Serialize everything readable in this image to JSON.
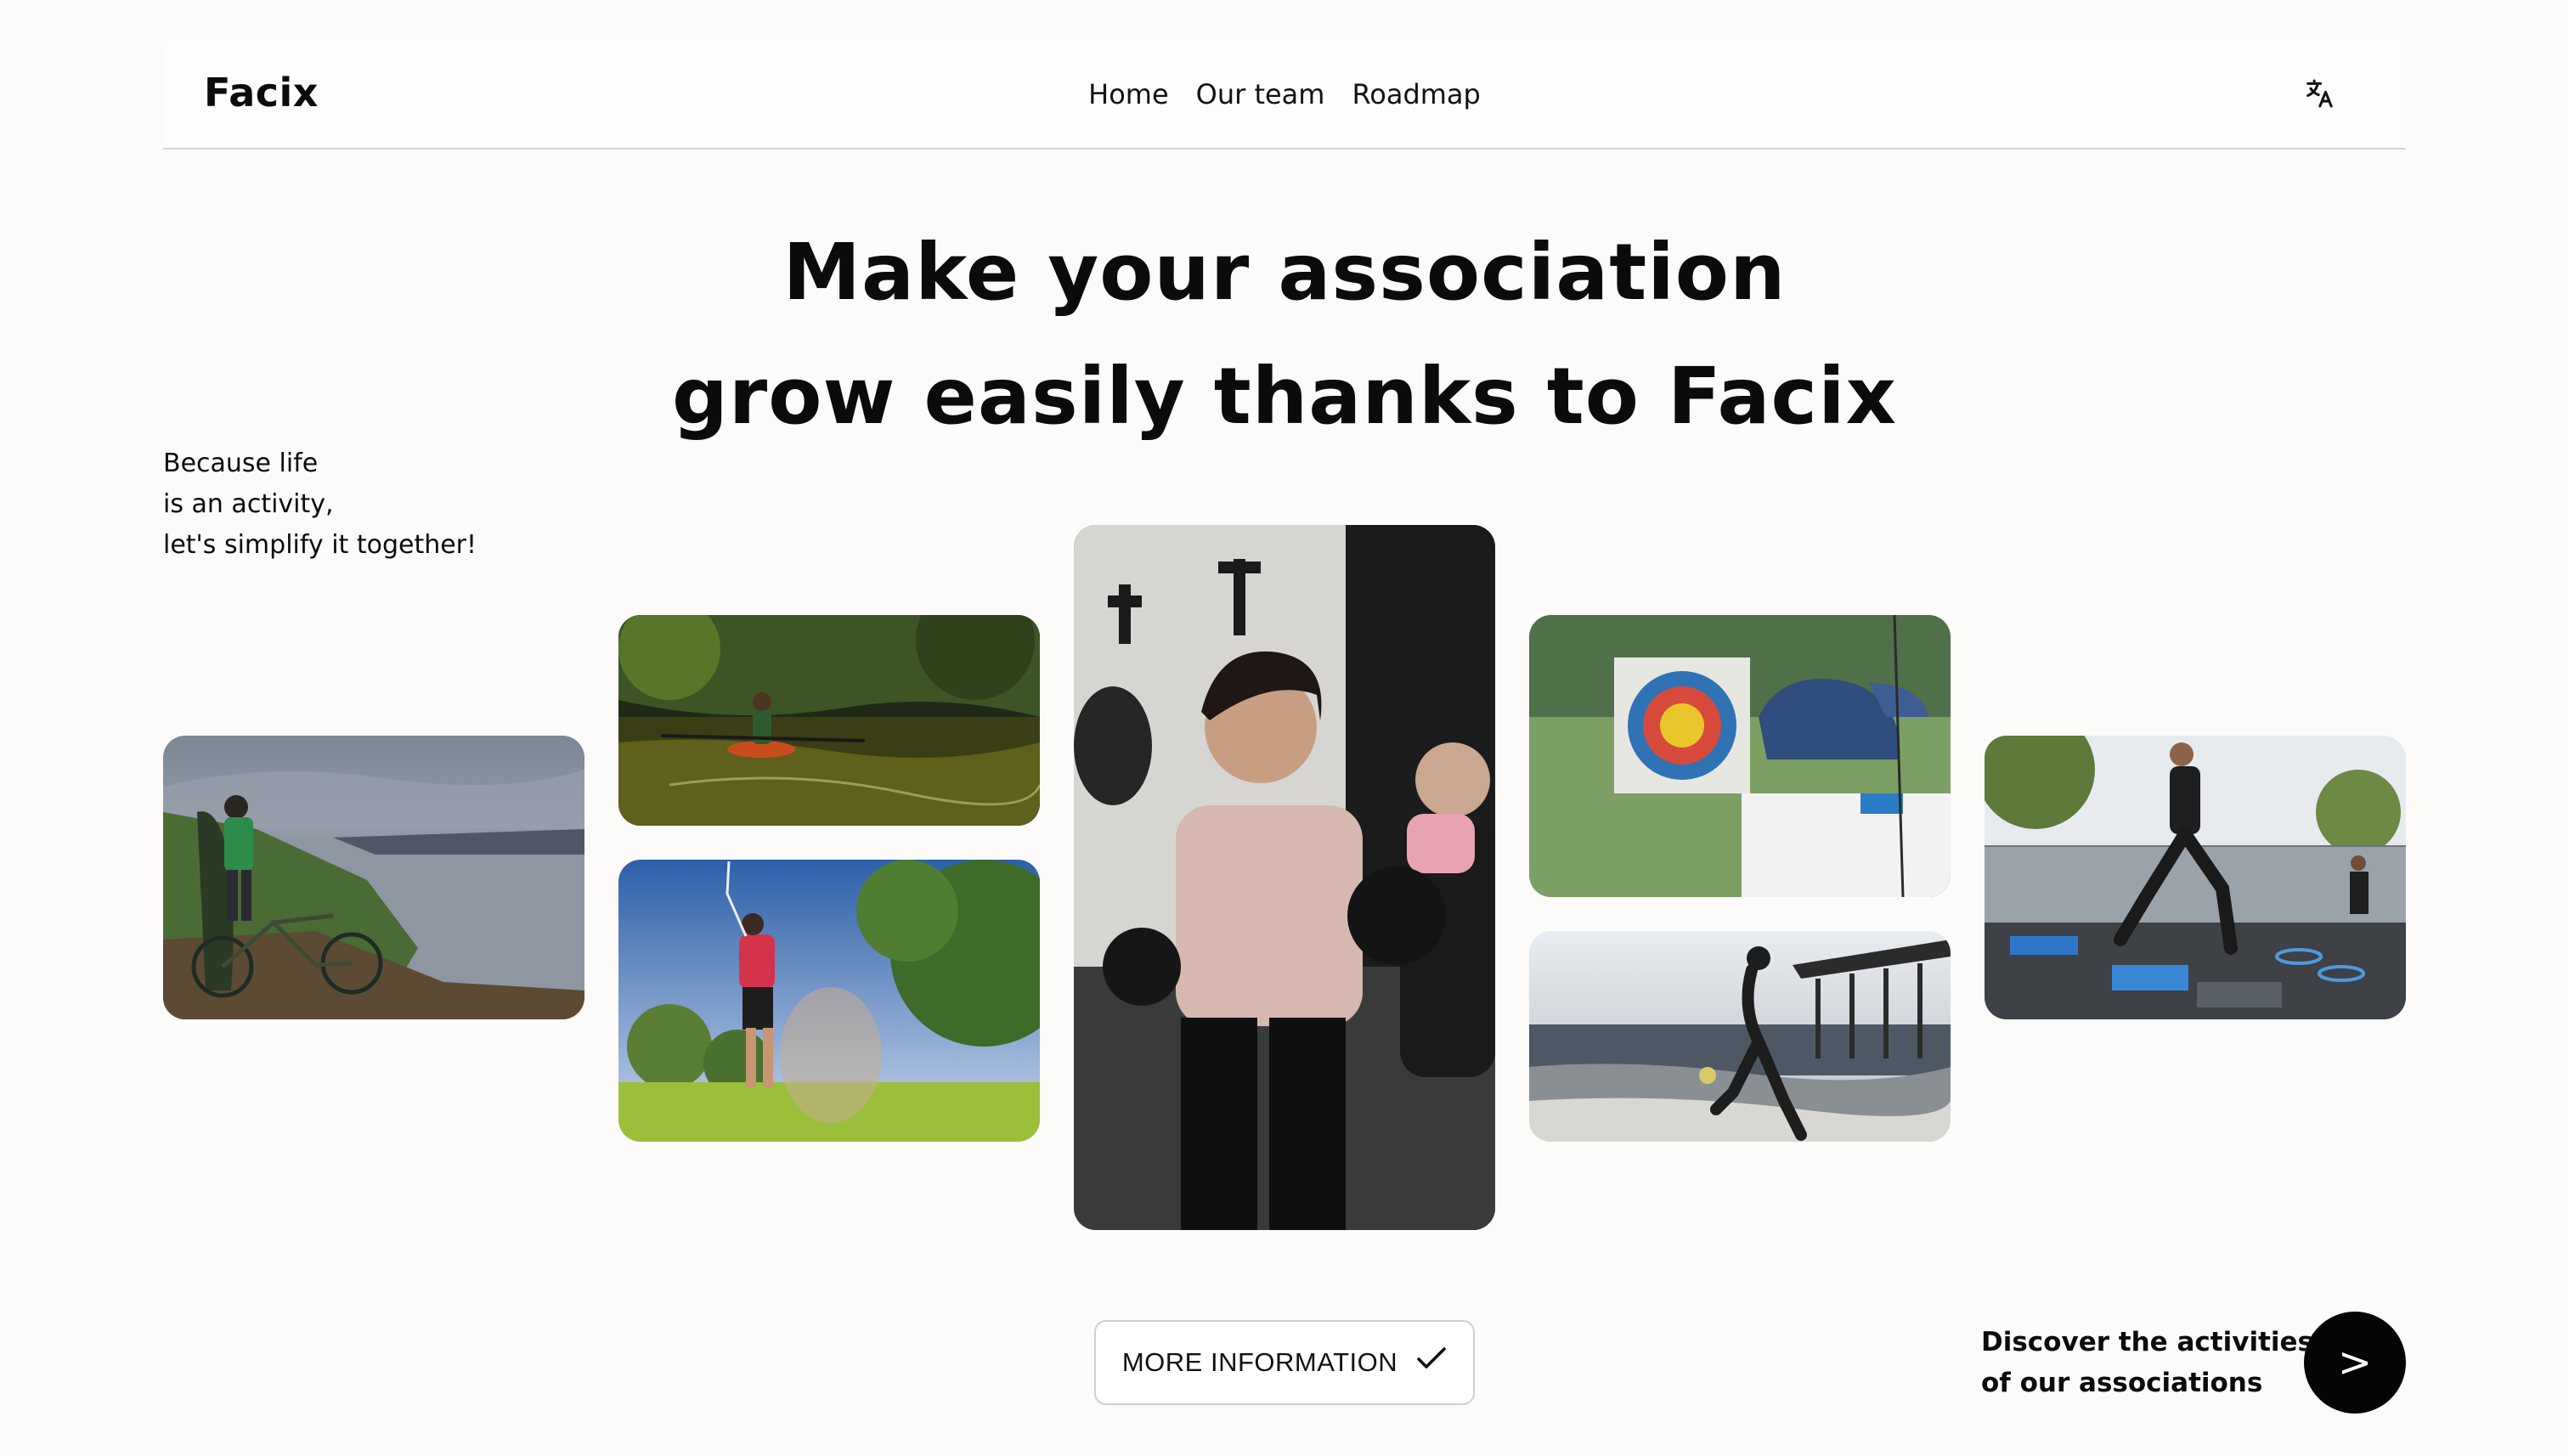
{
  "header": {
    "logo": "Facix",
    "nav": [
      "Home",
      "Our team",
      "Roadmap"
    ],
    "language_icon": "translate-icon"
  },
  "hero": {
    "title_line1": "Make your association",
    "title_line2": "grow easily thanks to Facix",
    "tagline": [
      "Because life",
      "is an activity,",
      "let's simplify it together!"
    ]
  },
  "photos": [
    "cyclist-on-cliff-photo",
    "kayaker-on-river-photo",
    "golfer-swing-photo",
    "boxing-women-photo",
    "archery-target-photo",
    "beach-runner-photo",
    "agility-training-photo"
  ],
  "cta": {
    "more_label": "MORE INFORMATION",
    "more_icon": "check-icon",
    "discover_line1": "Discover the activities",
    "discover_line2": "of our associations",
    "next_label": ">"
  },
  "colors": {
    "background": "#fcfbfa",
    "text": "#0b0b0b",
    "accent_button": "#050505"
  }
}
